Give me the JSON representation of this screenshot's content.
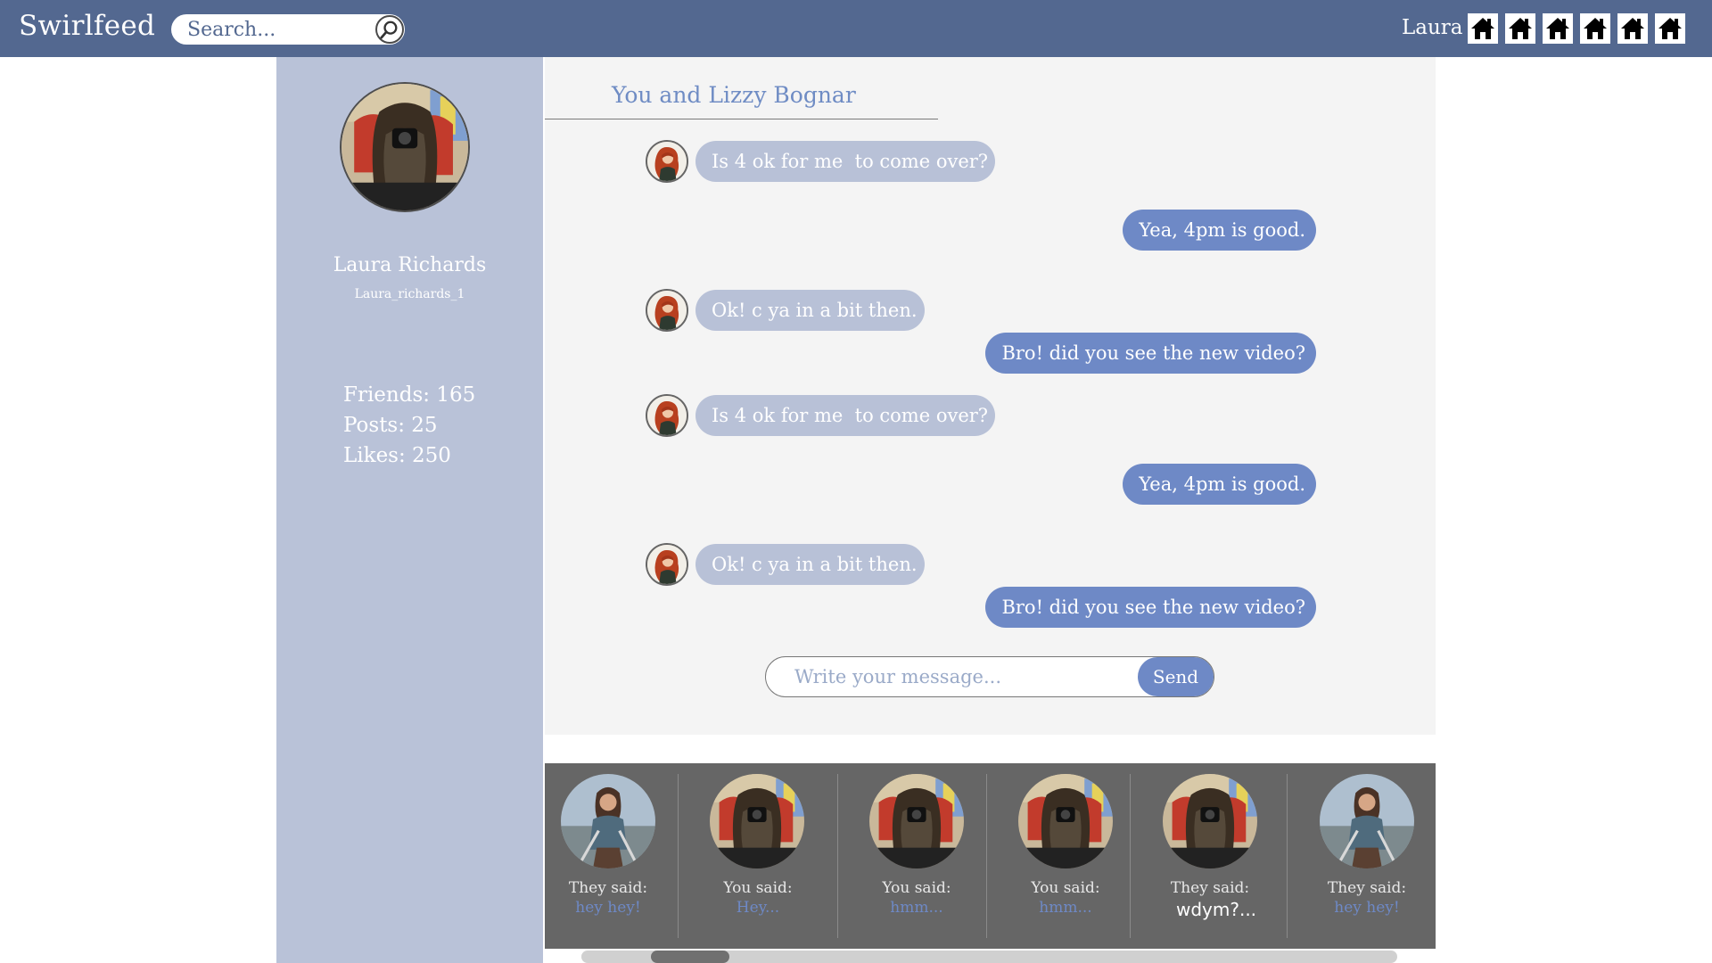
{
  "app": {
    "name": "Swirlfeed"
  },
  "search": {
    "placeholder": "Search..."
  },
  "header": {
    "user_name": "Laura",
    "home_icon_count": 6
  },
  "profile": {
    "name": "Laura Richards",
    "handle": "Laura_richards_1",
    "friends": "Friends: 165",
    "posts": "Posts: 25",
    "likes": "Likes: 250"
  },
  "chat": {
    "title": "You and Lizzy Bognar",
    "messages": [
      {
        "from": "them",
        "text": "Is 4 ok for me  to come over?"
      },
      {
        "from": "me",
        "text": "Yea, 4pm is good."
      },
      {
        "from": "them",
        "text": "Ok! c ya in a bit then."
      },
      {
        "from": "me",
        "text": "Bro! did you see the new video?"
      },
      {
        "from": "them",
        "text": "Is 4 ok for me  to come over?"
      },
      {
        "from": "me",
        "text": "Yea, 4pm is good."
      },
      {
        "from": "them",
        "text": "Ok! c ya in a bit then."
      },
      {
        "from": "me",
        "text": "Bro! did you see the new video?"
      }
    ],
    "composer_placeholder": "Write your message...",
    "send_label": "Send"
  },
  "conversations": [
    {
      "label": "They said:",
      "preview": "hey hey!",
      "avatar": "warrior",
      "unread": false
    },
    {
      "label": "You said:",
      "preview": "Hey...",
      "avatar": "camera",
      "unread": false
    },
    {
      "label": "You said:",
      "preview": "hmm...",
      "avatar": "camera",
      "unread": false
    },
    {
      "label": "You said:",
      "preview": "hmm...",
      "avatar": "camera",
      "unread": false
    },
    {
      "label": "They said:",
      "preview": "wdym?...",
      "avatar": "camera",
      "unread": true
    },
    {
      "label": "They said:",
      "preview": "hey hey!",
      "avatar": "warrior",
      "unread": false
    }
  ],
  "colors": {
    "header": "#536890",
    "sidebar": "#b9c2d8",
    "bubble_in": "#b8c1d7",
    "bubble_out": "#6e89c6",
    "strip": "#666666"
  }
}
